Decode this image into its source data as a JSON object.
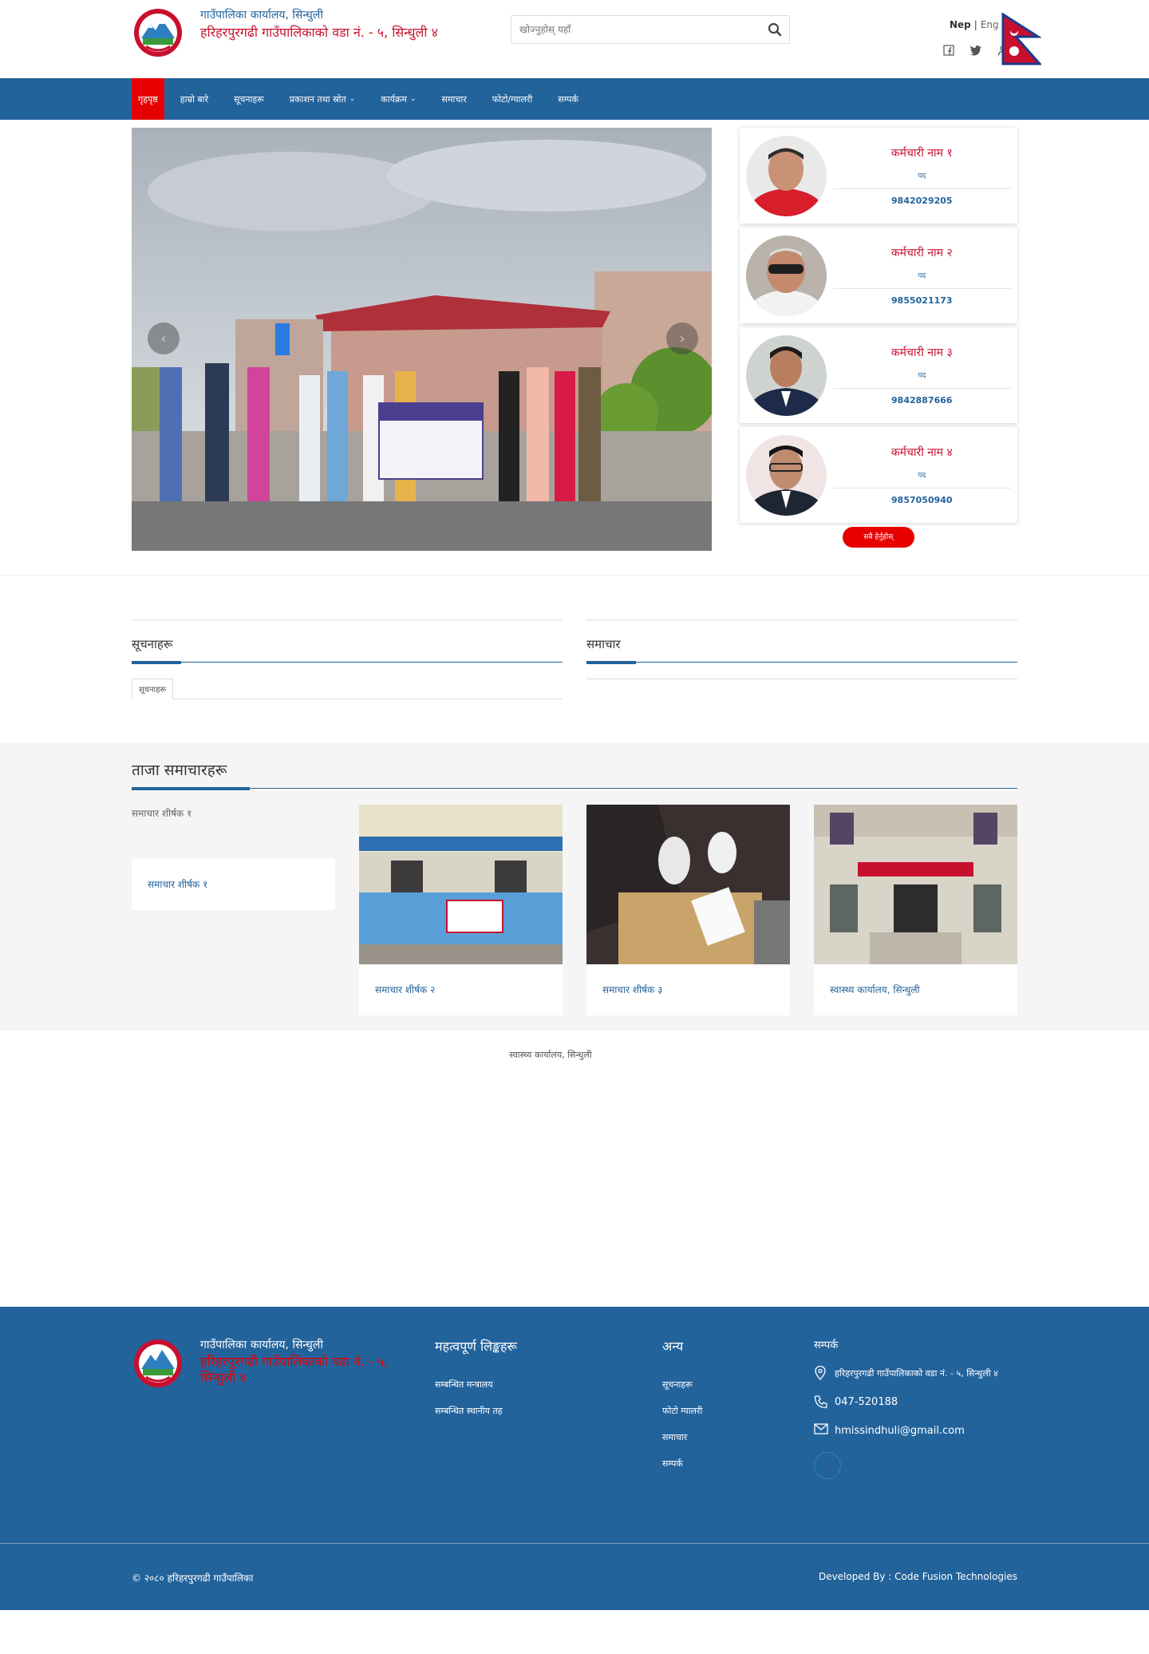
{
  "header": {
    "org_line1": "गाउँपालिका कार्यालय, सिन्धुली",
    "org_line2": "हरिहरपुरगढी गाउँपालिकाको वडा नं. - ५, सिन्धुली ४",
    "search_placeholder": "खोज्नुहोस् यहाँ",
    "lang_nep": "Nep",
    "lang_sep": "|",
    "lang_eng": "Eng",
    "social_icons": [
      "facebook-icon",
      "twitter-icon",
      "user-icon"
    ]
  },
  "nav": {
    "items": [
      {
        "label": "गृहपृष्ठ",
        "active": true,
        "dropdown": false
      },
      {
        "label": "हाम्रो बारे",
        "active": false,
        "dropdown": false
      },
      {
        "label": "सूचनाहरू",
        "active": false,
        "dropdown": false
      },
      {
        "label": "प्रकाशन तथा स्रोत",
        "active": false,
        "dropdown": true
      },
      {
        "label": "कार्यक्रम",
        "active": false,
        "dropdown": true
      },
      {
        "label": "समाचार",
        "active": false,
        "dropdown": false
      },
      {
        "label": "फोटो/ग्यालरी",
        "active": false,
        "dropdown": false
      },
      {
        "label": "सम्पर्क",
        "active": false,
        "dropdown": false
      }
    ]
  },
  "staff": [
    {
      "name": "कर्मचारी नाम १",
      "role": "पद",
      "phone": "9842029205"
    },
    {
      "name": "कर्मचारी नाम २",
      "role": "पद",
      "phone": "9855021173"
    },
    {
      "name": "कर्मचारी नाम ३",
      "role": "पद",
      "phone": "9842887666"
    },
    {
      "name": "कर्मचारी नाम ४",
      "role": "पद",
      "phone": "9857050940"
    }
  ],
  "staff_all_button": "सबै हेर्नुहोस्",
  "notice": {
    "left_title": "सूचनाहरू",
    "left_tab": "सूचनाहरू",
    "right_title": "समाचार"
  },
  "news": {
    "title": "ताजा समाचारहरू",
    "items": [
      {
        "alt": "समाचार शीर्षक १",
        "caption": "समाचार शीर्षक १"
      },
      {
        "caption": "समाचार शीर्षक २"
      },
      {
        "caption": "समाचार शीर्षक ३"
      },
      {
        "caption": "स्वास्थ्य कार्यालय, सिन्धुली"
      }
    ]
  },
  "map_title": "स्वास्थ्य कार्यालय, सिन्धुली",
  "footer": {
    "org_line1": "गाउँपालिका कार्यालय, सिन्धुली",
    "org_line2": "हरिहरपुरगढी गाउँपालिकाको वडा नं. - ५, सिन्धुली ४",
    "col2_title": "महत्वपूर्ण लिङ्कहरू",
    "col2_links": [
      "सम्बन्धित मन्त्रालय",
      "सम्बन्धित स्थानीय तह"
    ],
    "col3_title": "अन्य",
    "col3_links": [
      "सूचनाहरू",
      "फोटो ग्यालरी",
      "समाचार",
      "सम्पर्क"
    ],
    "col4_title": "सम्पर्क",
    "address": "हरिहरपुरगढी गाउँपालिकाको वडा नं. - ५, सिन्धुली ४",
    "phone": "047-520188",
    "email": "hmissindhuli@gmail.com",
    "copyright": "© २०८० हरिहरपुरगढी गाउँपालिका",
    "developer": "Developed By : Code Fusion Technologies"
  }
}
